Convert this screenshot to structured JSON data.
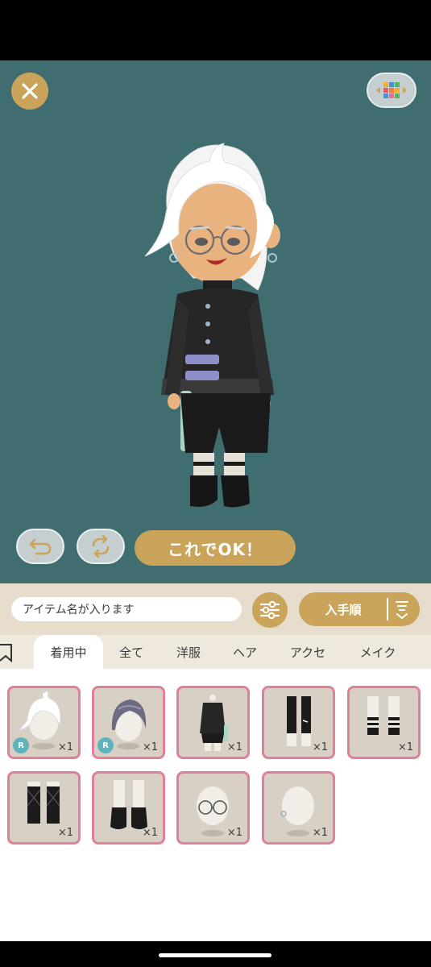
{
  "stage": {
    "close_icon": "close-icon",
    "palette_icon": "color-palette-icon",
    "undo_icon": "undo-arrow-icon",
    "rotate_icon": "rotate-icon",
    "confirm_label": "これでOK！"
  },
  "toolbar": {
    "search_placeholder": "アイテム名が入ります",
    "filter_icon": "sliders-icon",
    "sort_label": "入手順",
    "sort_icon": "sort-descending-icon"
  },
  "tabs": [
    {
      "label": "着用中",
      "active": true
    },
    {
      "label": "全て",
      "active": false
    },
    {
      "label": "洋服",
      "active": false
    },
    {
      "label": "ヘア",
      "active": false
    },
    {
      "label": "アクセ",
      "active": false
    },
    {
      "label": "メイク",
      "active": false
    }
  ],
  "items": [
    {
      "kind": "white-hair",
      "quantity": "×1",
      "rarity": "R"
    },
    {
      "kind": "purple-hair",
      "quantity": "×1",
      "rarity": "R"
    },
    {
      "kind": "black-outfit",
      "quantity": "×1",
      "rarity": ""
    },
    {
      "kind": "black-long-socks",
      "quantity": "×1",
      "rarity": ""
    },
    {
      "kind": "striped-socks",
      "quantity": "×1",
      "rarity": ""
    },
    {
      "kind": "argyle-socks",
      "quantity": "×1",
      "rarity": ""
    },
    {
      "kind": "black-boots",
      "quantity": "×1",
      "rarity": ""
    },
    {
      "kind": "round-glasses",
      "quantity": "×1",
      "rarity": ""
    },
    {
      "kind": "earrings",
      "quantity": "×1",
      "rarity": ""
    }
  ],
  "colors": {
    "stage_background": "#3f6d70",
    "accent_gold": "#c9a45a",
    "item_border": "#e0809b",
    "rarity_badge": "#5fb3ba"
  }
}
